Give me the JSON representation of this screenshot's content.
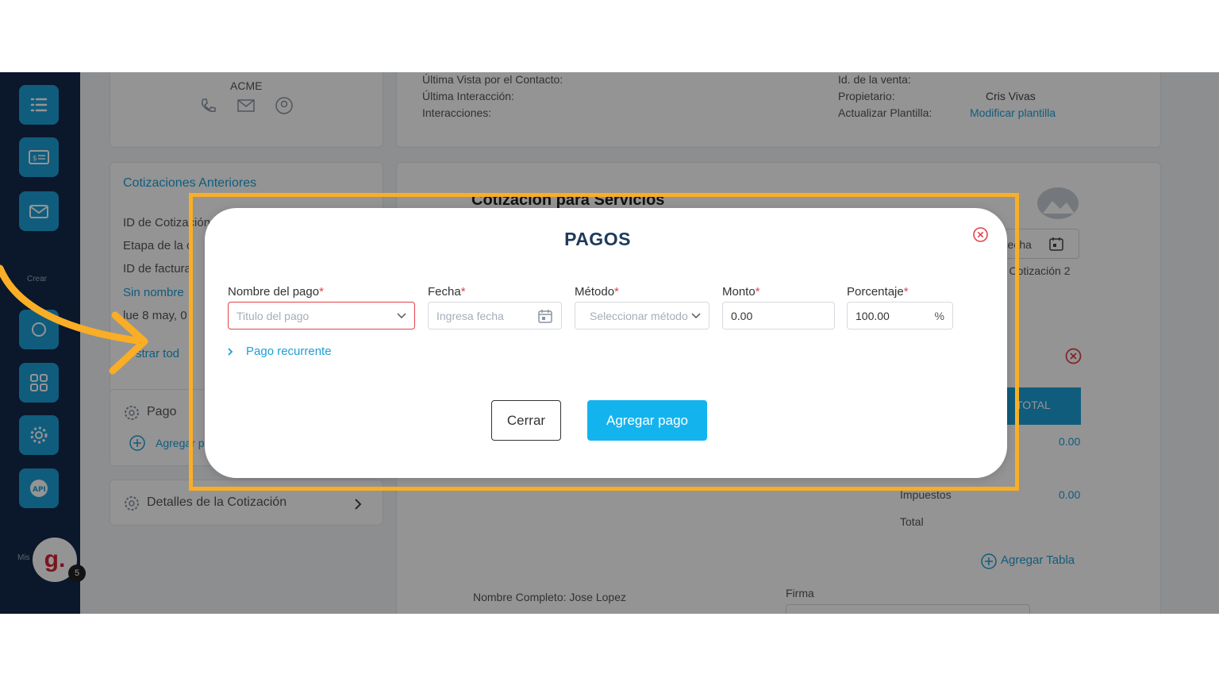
{
  "background": {
    "contact_card": {
      "company": "ACME"
    },
    "info_left": [
      "Última Vista por el Contacto:",
      "Última Interacción:",
      "Interacciones:"
    ],
    "info_right": {
      "id_venta_label": "Id. de la venta:",
      "propietario_label": "Propietario:",
      "propietario_value": "Cris Vivas",
      "plantilla_label": "Actualizar Plantilla:",
      "plantilla_link": "Modificar plantilla"
    },
    "cotizaciones": {
      "title": "Cotizaciones Anteriores",
      "rows": [
        "ID de Cotización",
        "Etapa de la c",
        "ID de factura"
      ],
      "sin_nombre": "Sin nombre",
      "fecha": "lue 8 may, 0",
      "mostrar": "strar tod"
    },
    "pago_card": {
      "label": "Pago",
      "agregar": "Agregar p"
    },
    "detalles": {
      "label": "Detalles de la Cotización"
    },
    "doc": {
      "title": "Cotización para Servicios",
      "fecha_label": "Fecha",
      "cotizacion_label": "de Cotización 2",
      "total_header": "TOTAL",
      "subtotal_value": "0.00",
      "impuestos_label": "Impuestos",
      "impuestos_value": "0.00",
      "total_label": "Total",
      "agregar_tabla": "Agregar Tabla",
      "nombre_completo": "Nombre Completo:  Jose Lopez",
      "firma": "Firma"
    },
    "sidebar": {
      "crear": "Crear",
      "mis": "Mis",
      "avatar": "g.",
      "badge": "5"
    }
  },
  "modal": {
    "title": "PAGOS",
    "fields": [
      {
        "label": "Nombre del pago",
        "placeholder": "Titulo del pago",
        "value": ""
      },
      {
        "label": "Fecha",
        "placeholder": "Ingresa fecha",
        "value": ""
      },
      {
        "label": "Método",
        "placeholder": "Seleccionar método",
        "value": ""
      },
      {
        "label": "Monto",
        "placeholder": "",
        "value": "0.00"
      },
      {
        "label": "Porcentaje",
        "placeholder": "",
        "value": "100.00",
        "suffix": "%"
      }
    ],
    "required_mark": "*",
    "recurrente": "Pago recurrente",
    "cerrar": "Cerrar",
    "agregar": "Agregar pago"
  },
  "colors": {
    "accent": "#1c9fd8",
    "primary_button": "#13b4ee",
    "highlight": "#f9ae26",
    "error": "#e2434b",
    "sidebar": "#13294a"
  }
}
